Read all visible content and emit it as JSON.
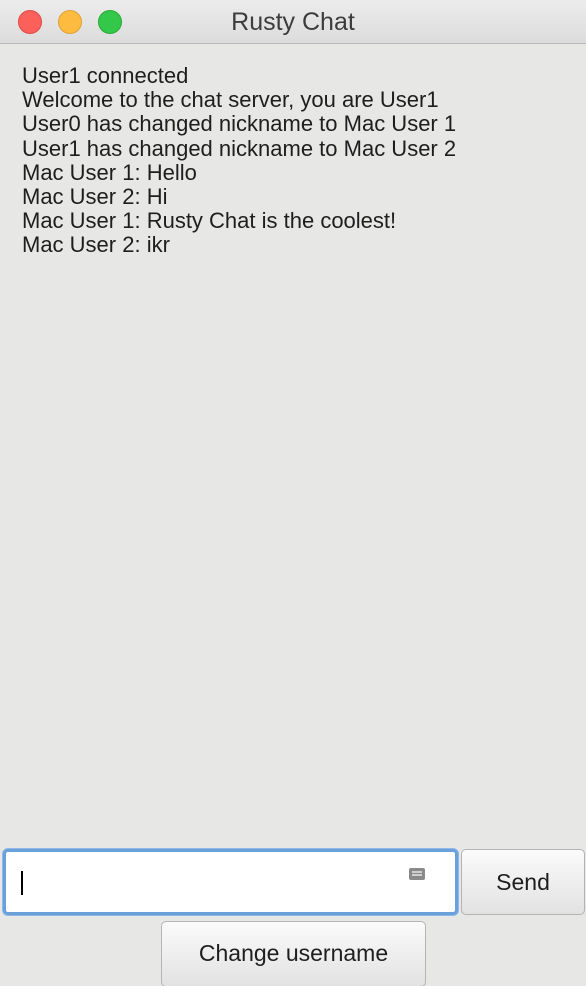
{
  "window": {
    "title": "Rusty Chat"
  },
  "chat": {
    "lines": [
      "User1 connected",
      "Welcome to the chat server, you are User1",
      "User0 has changed nickname to Mac User 1",
      "User1 has changed nickname to Mac User 2",
      "Mac User 1: Hello",
      "Mac User 2: Hi",
      "Mac User 1: Rusty Chat is the coolest!",
      "Mac User 2: ikr"
    ]
  },
  "composer": {
    "value": "",
    "send_label": "Send",
    "change_username_label": "Change username"
  },
  "colors": {
    "close": "#fc605b",
    "minimize": "#fdbc40",
    "maximize": "#34c84a",
    "focus_ring": "#6aa0dc"
  }
}
